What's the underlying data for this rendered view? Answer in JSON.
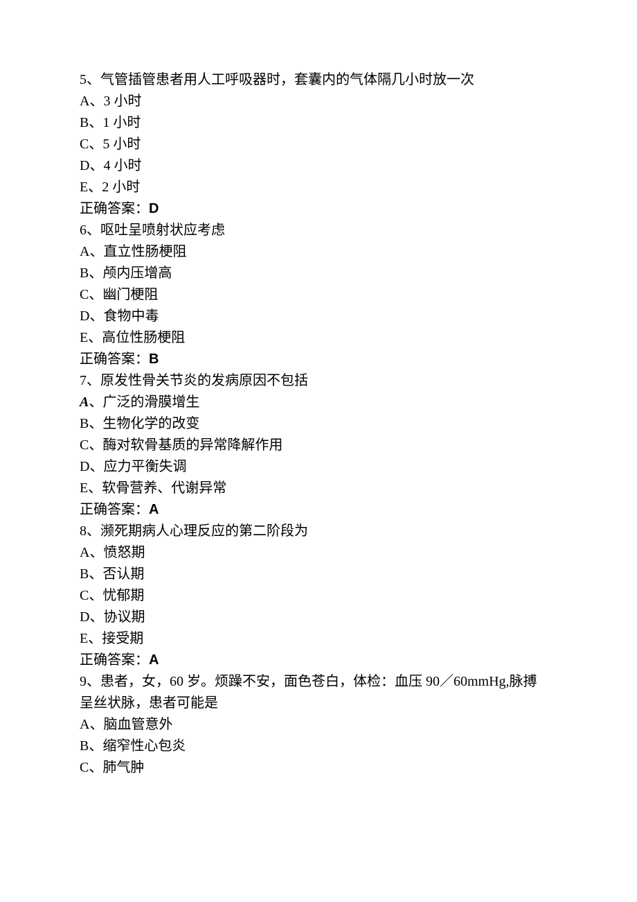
{
  "answer_label": "正确答案：",
  "questions": [
    {
      "stem": "5、气管插管患者用人工呼吸器时，套囊内的气体隔几小时放一次",
      "options": [
        "A、3 小时",
        "B、1 小时",
        "C、5 小时",
        "D、4 小时",
        "E、2 小时"
      ],
      "answer": "D"
    },
    {
      "stem": "6、呕吐呈喷射状应考虑",
      "options": [
        "A、直立性肠梗阻",
        "B、颅内压增高",
        "C、幽门梗阻",
        "D、食物中毒",
        "E、高位性肠梗阻"
      ],
      "answer": "B"
    },
    {
      "stem": "7、原发性骨关节炎的发病原因不包括",
      "option_a_prefix": "A",
      "option_a_rest": "、广泛的滑膜增生",
      "options_rest": [
        "B、生物化学的改变",
        "C、酶对软骨基质的异常降解作用",
        "D、应力平衡失调",
        "E、软骨营养、代谢异常"
      ],
      "answer": "A"
    },
    {
      "stem": "8、濒死期病人心理反应的第二阶段为",
      "options": [
        "A、愤怒期",
        "B、否认期",
        "C、忧郁期",
        "D、协议期",
        "E、接受期"
      ],
      "answer": "A"
    },
    {
      "stem_lines": [
        "9、患者，女，60 岁。烦躁不安，面色苍白，体检：血压 90／60mmHg,脉搏",
        "呈丝状脉，患者可能是"
      ],
      "options": [
        "A、脑血管意外",
        "B、缩窄性心包炎",
        "C、肺气肿"
      ]
    }
  ]
}
